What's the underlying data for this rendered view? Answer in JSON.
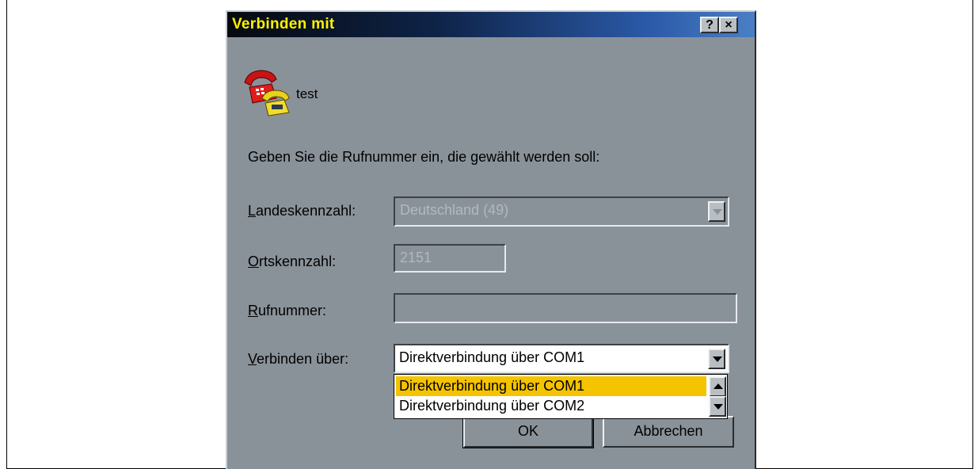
{
  "dialog": {
    "title": "Verbinden mit",
    "help_glyph": "?",
    "close_glyph": "×",
    "icon": "phone-icon",
    "connection_name": "test",
    "prompt": "Geben Sie die Rufnummer ein, die gewählt werden soll:"
  },
  "fields": {
    "country": {
      "label_access": "L",
      "label_rest": "andeskennzahl:",
      "value": "Deutschland (49)"
    },
    "area": {
      "label_access": "O",
      "label_rest": "rtskennzahl:",
      "value": "2151"
    },
    "phone": {
      "label_access": "R",
      "label_rest": "ufnummer:",
      "value": ""
    },
    "connect": {
      "label_access": "V",
      "label_rest": "erbinden über:",
      "value": "Direktverbindung über COM1",
      "options": [
        "Direktverbindung über COM1",
        "Direktverbindung über COM2"
      ]
    }
  },
  "buttons": {
    "ok": "OK",
    "cancel": "Abbrechen"
  },
  "colors": {
    "title_text": "#fff200",
    "selected_option": "#f5c300",
    "dialog_face": "#8a9299"
  }
}
